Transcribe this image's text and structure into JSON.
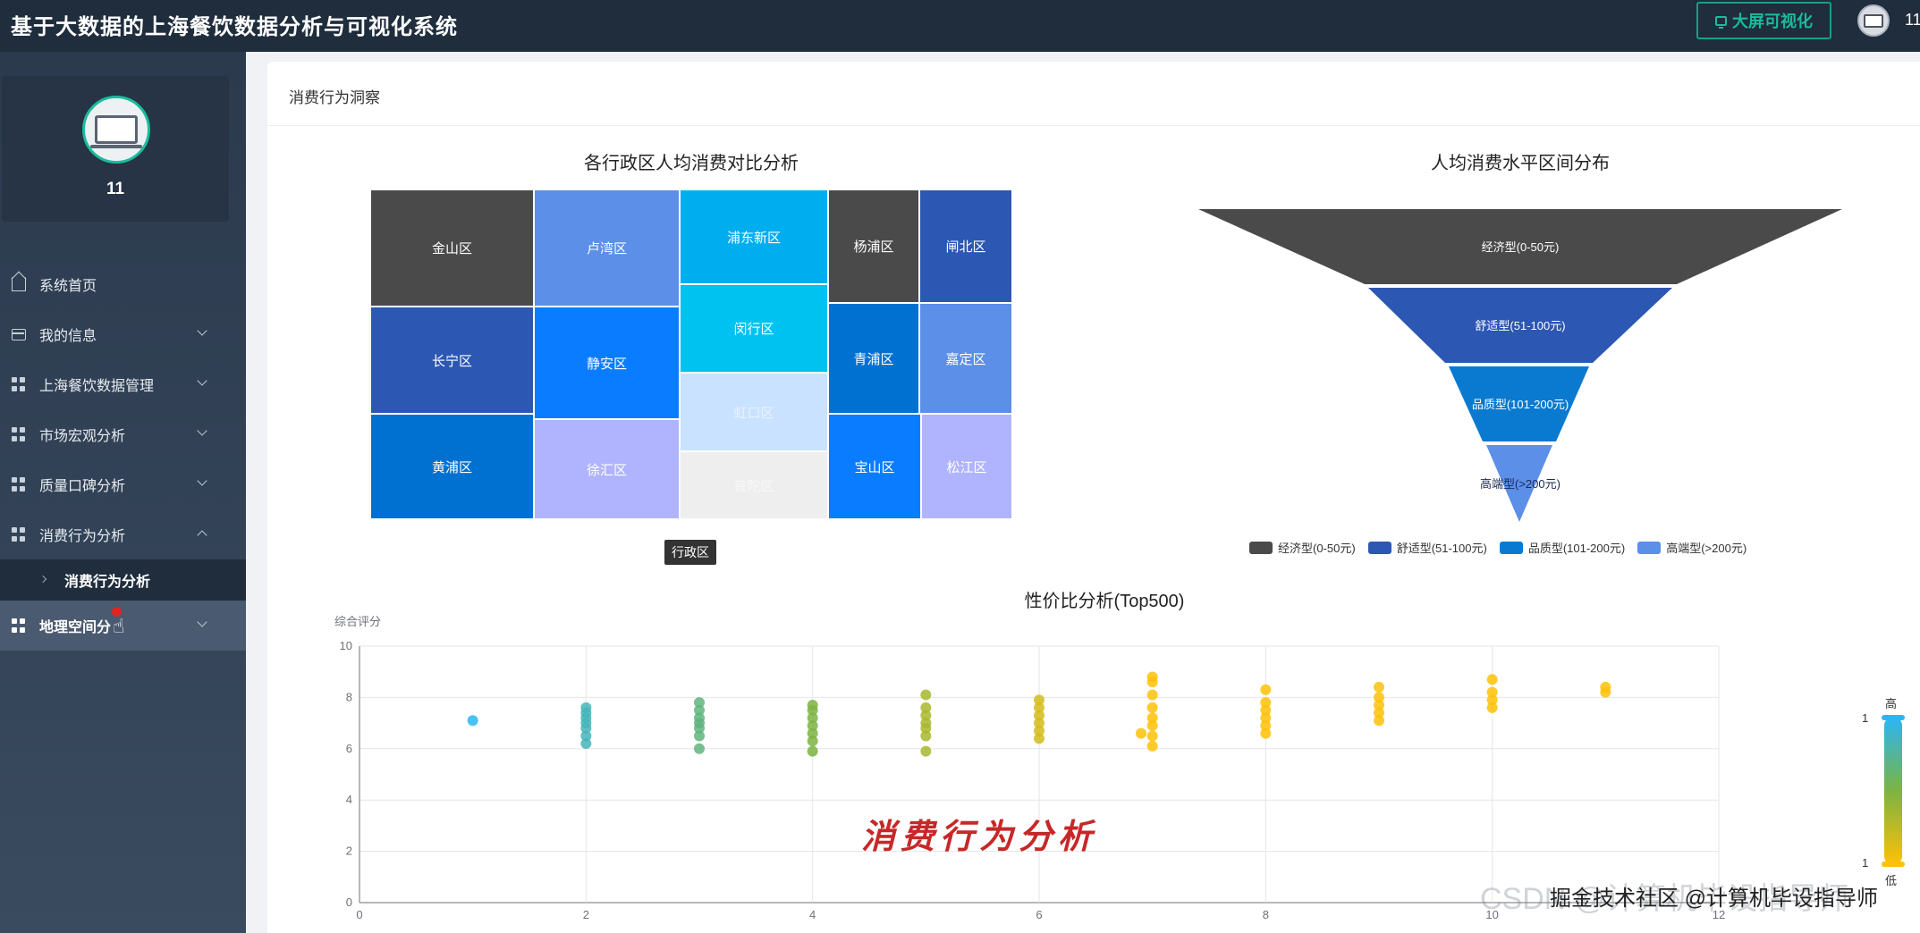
{
  "header": {
    "app_title": "基于大数据的上海餐饮数据分析与可视化系统",
    "bigscreen_label": "大屏可视化",
    "user_name": "11"
  },
  "sidebar": {
    "profile_name": "11",
    "items": [
      {
        "label": "系统首页",
        "icon": "home-icon"
      },
      {
        "label": "我的信息",
        "icon": "card-icon"
      },
      {
        "label": "上海餐饮数据管理",
        "icon": "grid-icon"
      },
      {
        "label": "市场宏观分析",
        "icon": "grid-icon"
      },
      {
        "label": "质量口碑分析",
        "icon": "grid-icon"
      },
      {
        "label": "消费行为分析",
        "icon": "grid-icon"
      },
      {
        "label": "地理空间分",
        "icon": "grid-icon"
      }
    ],
    "sub_item": "消费行为分析"
  },
  "panel": {
    "title": "消费行为洞察"
  },
  "overlay_caption": "消费行为分析",
  "watermark": "CSDN @计算机毕设指导师",
  "credit": "掘金技术社区 @计算机毕设指导师",
  "chart_data": [
    {
      "type": "treemap",
      "title": "各行政区人均消费对比分析",
      "legend": [
        "行政区"
      ],
      "items": [
        {
          "name": "金山区",
          "color": "#4a4a4a"
        },
        {
          "name": "卢湾区",
          "color": "#5b8fe8"
        },
        {
          "name": "浦东新区",
          "color": "#00aef0"
        },
        {
          "name": "杨浦区",
          "color": "#4a4a4a"
        },
        {
          "name": "闸北区",
          "color": "#2c57b2"
        },
        {
          "name": "长宁区",
          "color": "#2c57b2"
        },
        {
          "name": "静安区",
          "color": "#0a7cff"
        },
        {
          "name": "闵行区",
          "color": "#00c2f0"
        },
        {
          "name": "青浦区",
          "color": "#0071d0"
        },
        {
          "name": "嘉定区",
          "color": "#5b8fe8"
        },
        {
          "name": "黄浦区",
          "color": "#0071d0"
        },
        {
          "name": "徐汇区",
          "color": "#b0b4ff"
        },
        {
          "name": "虹口区",
          "color": "#c9e2ff"
        },
        {
          "name": "普陀区",
          "color": "#eeeeee"
        },
        {
          "name": "宝山区",
          "color": "#0a7cff"
        },
        {
          "name": "松江区",
          "color": "#b0b4ff"
        }
      ]
    },
    {
      "type": "funnel",
      "title": "人均消费水平区间分布",
      "items": [
        {
          "name": "经济型(0-50元)",
          "color": "#4a4a4a"
        },
        {
          "name": "舒适型(51-100元)",
          "color": "#2c57b2"
        },
        {
          "name": "品质型(101-200元)",
          "color": "#0a7ad0"
        },
        {
          "name": "高端型(>200元)",
          "color": "#5b8fe8"
        }
      ]
    },
    {
      "type": "scatter",
      "title": "性价比分析(Top500)",
      "ylabel": "综合评分",
      "xlim": [
        0,
        12
      ],
      "ylim": [
        0,
        10
      ],
      "xticks": [
        0,
        2,
        4,
        6,
        8,
        10,
        12
      ],
      "yticks": [
        0,
        2,
        4,
        6,
        8,
        10
      ],
      "visual_map": {
        "top_label": "高",
        "bottom_label": "低",
        "max": 1,
        "min": 1
      },
      "points": [
        [
          1,
          7.1
        ],
        [
          2,
          6.2
        ],
        [
          2,
          6.5
        ],
        [
          2,
          6.8
        ],
        [
          2,
          7.0
        ],
        [
          2,
          7.2
        ],
        [
          2,
          7.4
        ],
        [
          2,
          7.6
        ],
        [
          3,
          6.0
        ],
        [
          3,
          6.5
        ],
        [
          3,
          6.8
        ],
        [
          3,
          7.0
        ],
        [
          3,
          7.2
        ],
        [
          3,
          7.5
        ],
        [
          3,
          7.8
        ],
        [
          4,
          5.9
        ],
        [
          4,
          6.3
        ],
        [
          4,
          6.6
        ],
        [
          4,
          6.9
        ],
        [
          4,
          7.2
        ],
        [
          4,
          7.5
        ],
        [
          4,
          7.7
        ],
        [
          5,
          5.9
        ],
        [
          5,
          6.5
        ],
        [
          5,
          6.8
        ],
        [
          5,
          7.0
        ],
        [
          5,
          7.3
        ],
        [
          5,
          7.6
        ],
        [
          5,
          8.1
        ],
        [
          6,
          6.4
        ],
        [
          6,
          6.7
        ],
        [
          6,
          7.0
        ],
        [
          6,
          7.3
        ],
        [
          6,
          7.6
        ],
        [
          6,
          7.9
        ],
        [
          6.9,
          6.6
        ],
        [
          7,
          6.1
        ],
        [
          7,
          6.5
        ],
        [
          7,
          6.9
        ],
        [
          7,
          7.2
        ],
        [
          7,
          7.6
        ],
        [
          7,
          8.1
        ],
        [
          7,
          8.6
        ],
        [
          7,
          8.8
        ],
        [
          8,
          6.6
        ],
        [
          8,
          6.9
        ],
        [
          8,
          7.2
        ],
        [
          8,
          7.5
        ],
        [
          8,
          7.8
        ],
        [
          8,
          8.3
        ],
        [
          9,
          7.1
        ],
        [
          9,
          7.4
        ],
        [
          9,
          7.7
        ],
        [
          9,
          8.0
        ],
        [
          9,
          8.4
        ],
        [
          10,
          7.6
        ],
        [
          10,
          7.9
        ],
        [
          10,
          8.2
        ],
        [
          10,
          8.7
        ],
        [
          11,
          8.2
        ],
        [
          11,
          8.4
        ]
      ]
    }
  ]
}
